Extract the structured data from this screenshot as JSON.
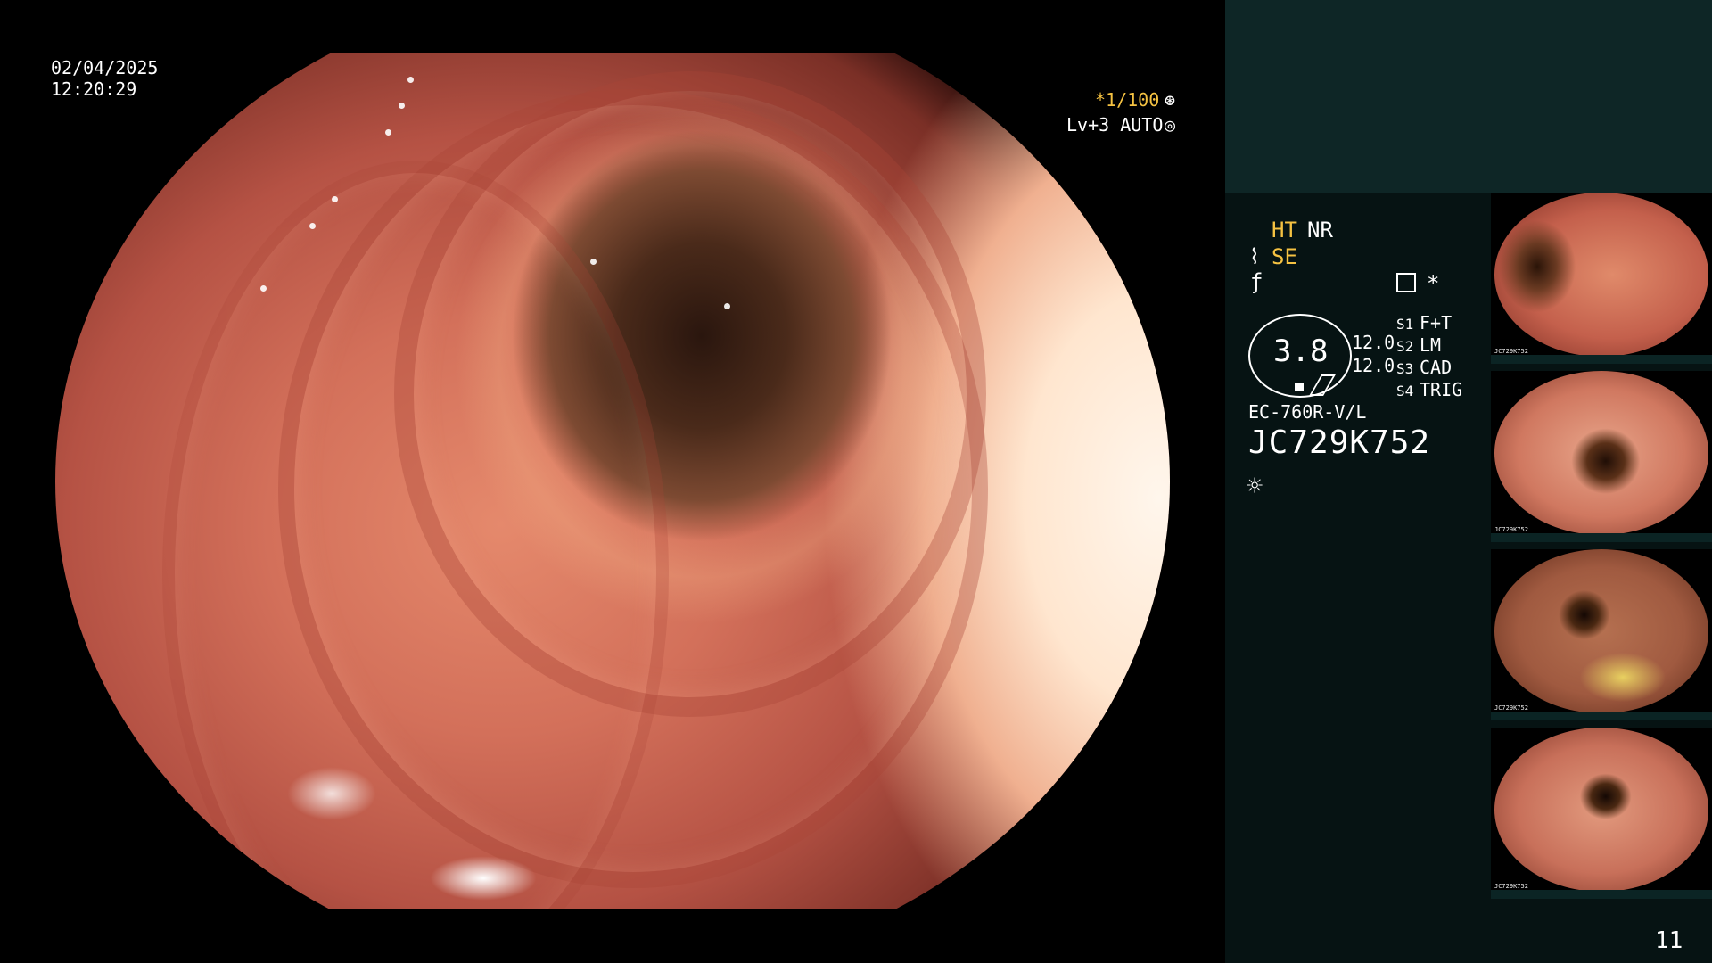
{
  "overlay": {
    "date": "02/04/2025",
    "time": "12:20:29",
    "shutter": "*1/100",
    "level": "Lv+3 AUTO"
  },
  "panel": {
    "ht": "HT",
    "nr": "NR",
    "se": "SE",
    "big_value": "3.8",
    "value_a": "12.0",
    "value_b": "12.0",
    "switches": [
      {
        "key": "S1",
        "val": "F+T"
      },
      {
        "key": "S2",
        "val": "LM"
      },
      {
        "key": "S3",
        "val": "CAD"
      },
      {
        "key": "S4",
        "val": "TRIG"
      }
    ],
    "scope_model": "EC-760R-V/L",
    "serial": "JC729K752"
  },
  "thumbnails": [
    {
      "label": "JC729K752"
    },
    {
      "label": "JC729K752"
    },
    {
      "label": "JC729K752"
    },
    {
      "label": "JC729K752"
    }
  ],
  "page_number": "11",
  "colors": {
    "accent_yellow": "#f5c242",
    "panel_bg": "#061313",
    "panel_top_bg": "#0e2626"
  }
}
